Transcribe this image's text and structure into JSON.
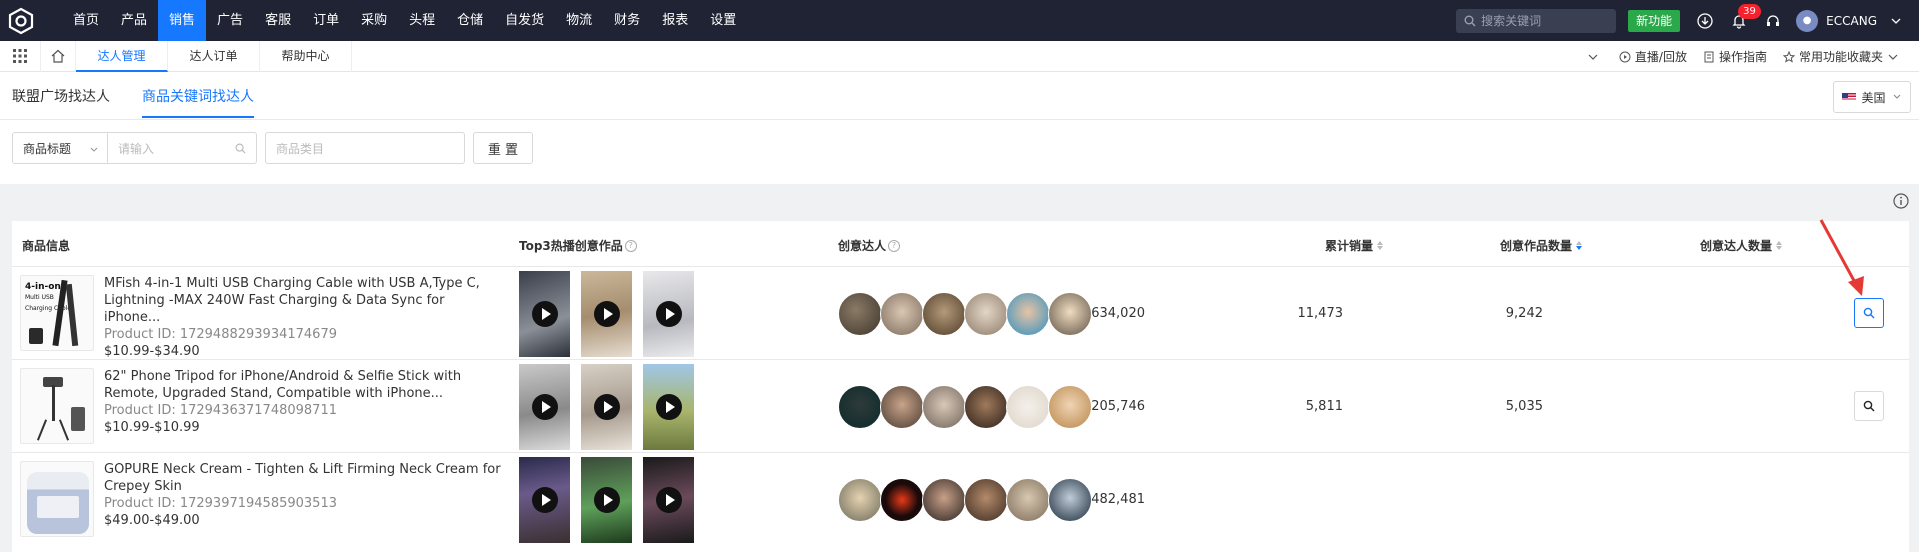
{
  "topnav": {
    "menu": [
      "首页",
      "产品",
      "销售",
      "广告",
      "客服",
      "订单",
      "采购",
      "头程",
      "仓储",
      "自发货",
      "物流",
      "财务",
      "报表",
      "设置"
    ],
    "active_index": 2,
    "search_placeholder": "搜索关键词",
    "new_feature": "新功能",
    "notification_count": "39",
    "username": "ECCANG"
  },
  "tabbar": {
    "tabs": [
      "达人管理",
      "达人订单",
      "帮助中心"
    ],
    "active_index": 0,
    "right": {
      "live": "直播/回放",
      "guide": "操作指南",
      "favorites": "常用功能收藏夹"
    }
  },
  "subtabs": [
    "联盟广场找达人",
    "商品关键词找达人"
  ],
  "subtab_active": 1,
  "country": "美国",
  "filters": {
    "field_select": "商品标题",
    "keyword_placeholder": "请输入",
    "category_placeholder": "商品类目",
    "reset": "重 置"
  },
  "table": {
    "headers": {
      "product": "商品信息",
      "top3": "Top3热播创意作品",
      "creators": "创意达人",
      "sales": "累计销量",
      "works": "创意作品数量",
      "creator_count": "创意达人数量"
    },
    "rows": [
      {
        "title": "MFish 4-in-1 Multi USB Charging Cable with USB A,Type C, Lightning -MAX 240W Fast Charging & Data Sync for iPhone...",
        "product_id": "Product ID:  1729488293934174679",
        "price": "$10.99-$34.90",
        "sales": "634,020",
        "works": "11,473",
        "creator_count": "9,242"
      },
      {
        "title": "62\" Phone Tripod for iPhone/Android & Selfie Stick with Remote, Upgraded Stand, Compatible with iPhone...",
        "product_id": "Product ID:  1729436371748098711",
        "price": "$10.99-$10.99",
        "sales": "205,746",
        "works": "5,811",
        "creator_count": "5,035"
      },
      {
        "title": "GOPURE Neck Cream - Tighten & Lift Firming Neck Cream for Crepey Skin",
        "product_id": "Product ID:  1729397194585903513",
        "price": "$49.00-$49.00",
        "sales": "482,481",
        "works": "",
        "creator_count": ""
      }
    ]
  },
  "colors": {
    "nav_bg": "#1f2333",
    "accent": "#1677ff",
    "new_btn": "#2ba84a",
    "arrow": "#e53935"
  }
}
